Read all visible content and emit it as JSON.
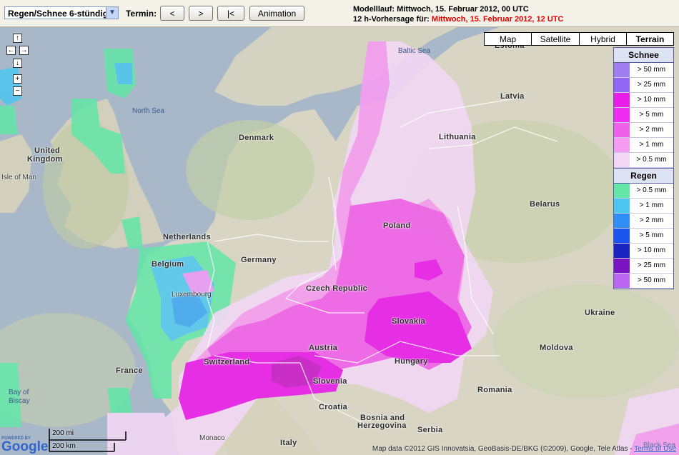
{
  "toolbar": {
    "product_select": "Regen/Schnee 6-stündig",
    "termin_label": "Termin:",
    "btn_prev": "<",
    "btn_next": ">",
    "btn_first": "|<",
    "btn_animation": "Animation",
    "model_run_prefix": "Modelllauf: Mittwoch, 15. Februar 2012, 00 UTC",
    "forecast_prefix": "12 h-Vorhersage für: ",
    "forecast_time": "Mittwoch, 15. Februar 2012, 12 UTC"
  },
  "map_types": [
    "Map",
    "Satellite",
    "Hybrid",
    "Terrain"
  ],
  "map_type_active": "Terrain",
  "nav": {
    "up": "↑",
    "left": "←",
    "right": "→",
    "down": "↓",
    "zoom_in": "+",
    "zoom_out": "−"
  },
  "legend_snow": {
    "title": "Schnee",
    "items": [
      {
        "label": "> 50 mm",
        "color": "#a07ef0"
      },
      {
        "label": "> 25 mm",
        "color": "#9166f5"
      },
      {
        "label": "> 10 mm",
        "color": "#e81ee8"
      },
      {
        "label": "> 5 mm",
        "color": "#f02cf0"
      },
      {
        "label": "> 2 mm",
        "color": "#f061ea"
      },
      {
        "label": "> 1 mm",
        "color": "#f59cf0"
      },
      {
        "label": "> 0.5 mm",
        "color": "#f2d8f5"
      }
    ]
  },
  "legend_rain": {
    "title": "Regen",
    "items": [
      {
        "label": "> 0.5 mm",
        "color": "#63e6a8"
      },
      {
        "label": "> 1 mm",
        "color": "#4dc6f0"
      },
      {
        "label": "> 2 mm",
        "color": "#2f8ff5"
      },
      {
        "label": "> 5 mm",
        "color": "#1a55f0"
      },
      {
        "label": "> 10 mm",
        "color": "#1a24c0"
      },
      {
        "label": "> 25 mm",
        "color": "#7a14c0"
      },
      {
        "label": "> 50 mm",
        "color": "#bb66f0"
      }
    ]
  },
  "map_labels": {
    "estonia": "Estonia",
    "baltic": "Baltic Sea",
    "latvia": "Latvia",
    "north_sea": "North Sea",
    "denmark": "Denmark",
    "lithuania": "Lithuania",
    "uk1": "United",
    "uk2": "Kingdom",
    "isle_of_man": "Isle of Man",
    "belarus": "Belarus",
    "netherlands": "Netherlands",
    "poland": "Poland",
    "germany": "Germany",
    "belgium": "Belgium",
    "luxembourg": "Luxembourg",
    "czech": "Czech Republic",
    "ukraine": "Ukraine",
    "slovakia": "Slovakia",
    "austria": "Austria",
    "moldova": "Moldova",
    "switzerland": "Switzerland",
    "hungary": "Hungary",
    "france": "France",
    "slovenia": "Slovenia",
    "romania": "Romania",
    "biscay1": "Bay of",
    "biscay2": "Biscay",
    "croatia": "Croatia",
    "bosnia1": "Bosnia and",
    "bosnia2": "Herzegovina",
    "serbia": "Serbia",
    "monaco": "Monaco",
    "italy": "Italy",
    "black_sea": "Black Sea"
  },
  "scale": {
    "mi": "200 mi",
    "km": "200 km"
  },
  "google": {
    "powered": "POWERED BY",
    "logo": "Google"
  },
  "attribution": {
    "text": "Map data ©2012 GIS Innovatsia, GeoBasis-DE/BKG (©2009), Google, Tele Atlas - ",
    "link": "Terms of Use"
  }
}
